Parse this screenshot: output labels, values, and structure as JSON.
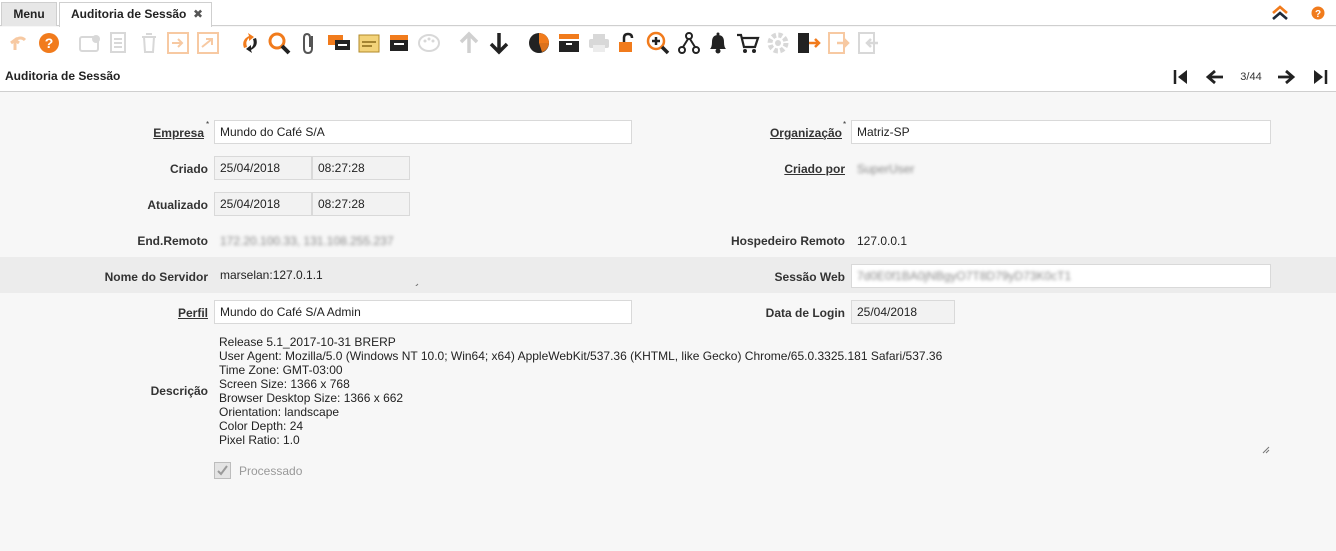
{
  "tabs": {
    "menu_label": "Menu",
    "active_label": "Auditoria de Sessão",
    "close_symbol": "✖"
  },
  "toolbar": {
    "icons": [
      "undo-icon",
      "help-icon",
      "new-record-icon",
      "copy-icon",
      "delete-icon",
      "save-icon",
      "save-new-icon",
      "refresh-icon",
      "find-icon",
      "attachment-icon",
      "chat-icon",
      "postit-icon",
      "history-icon",
      "customize-icon",
      "previous-record-icon",
      "next-record-icon",
      "report-icon",
      "archive-icon",
      "print-icon",
      "lock-icon",
      "zoom-across-icon",
      "workflow-icon",
      "alert-icon",
      "product-info-icon",
      "process-icon",
      "exit-icon",
      "import-icon",
      "export-icon"
    ],
    "accent": "#f17b1c",
    "dark": "#222222",
    "disabled": "#d8d8d8"
  },
  "window": {
    "title": "Auditoria de Sessão",
    "record_count": "3/44"
  },
  "form": {
    "empresa": {
      "label": "Empresa",
      "required": "*",
      "value": "Mundo do Café S/A"
    },
    "organizacao": {
      "label": "Organização",
      "required": "*",
      "value": "Matriz-SP"
    },
    "criado": {
      "label": "Criado",
      "date": "25/04/2018",
      "time": "08:27:28"
    },
    "criado_por": {
      "label": "Criado por",
      "value": "SuperUser"
    },
    "atualizado": {
      "label": "Atualizado",
      "date": "25/04/2018",
      "time": "08:27:28"
    },
    "end_remoto": {
      "label": "End.Remoto",
      "value": "172.20.100.33, 131.108.255.237"
    },
    "hospedeiro_remoto": {
      "label": "Hospedeiro Remoto",
      "value": "127.0.0.1"
    },
    "nome_servidor": {
      "label": "Nome do Servidor",
      "value": "marselan:127.0.1.1"
    },
    "sessao_web": {
      "label": "Sessão Web",
      "value": "7d0E0f1BA0jNBgyO7T8D79yD73K0cT1"
    },
    "perfil": {
      "label": "Perfil",
      "value": "Mundo do Café S/A Admin"
    },
    "data_login": {
      "label": "Data de Login",
      "value": "25/04/2018"
    },
    "descricao": {
      "label": "Descrição",
      "lines": [
        "Release 5.1_2017-10-31 BRERP",
        "User Agent: Mozilla/5.0 (Windows NT 10.0; Win64; x64) AppleWebKit/537.36 (KHTML, like Gecko) Chrome/65.0.3325.181 Safari/537.36",
        "Time Zone: GMT-03:00",
        "Screen Size: 1366 x 768",
        "Browser Desktop Size: 1366 x 662",
        "Orientation: landscape",
        "Color Depth: 24",
        "Pixel Ratio: 1.0"
      ]
    },
    "processado": {
      "label": "Processado",
      "checked": true
    }
  }
}
